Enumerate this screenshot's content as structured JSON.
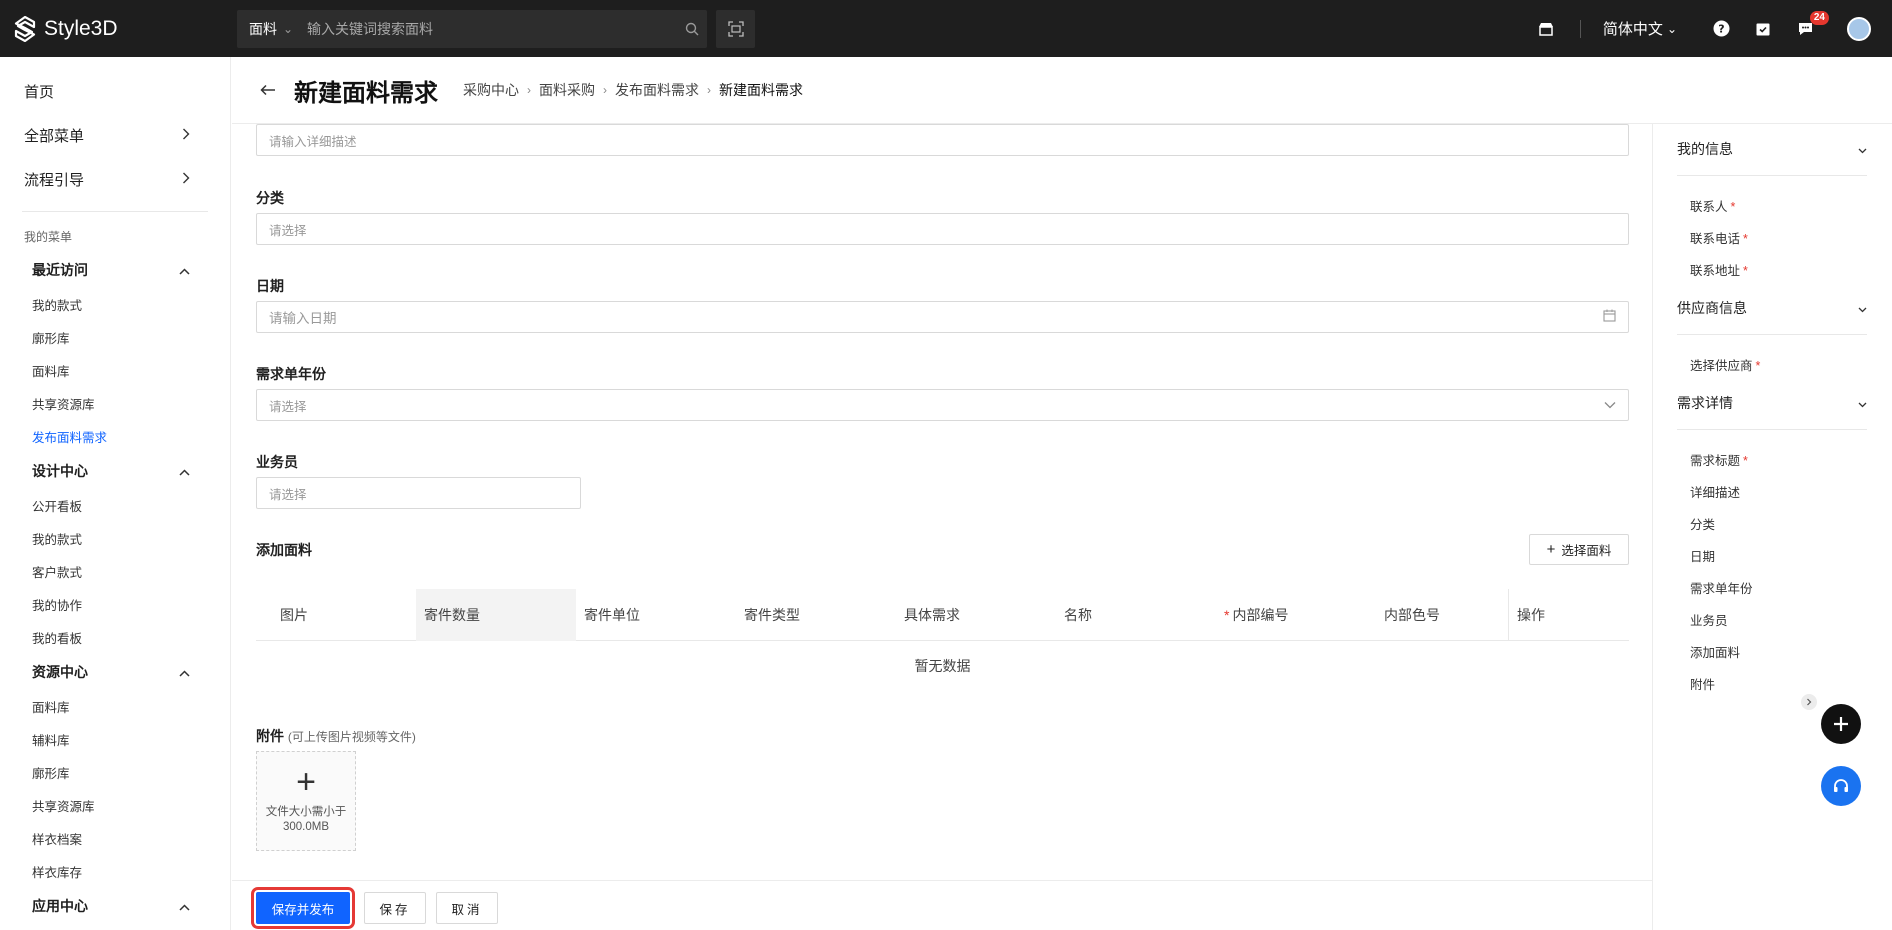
{
  "app": {
    "logo_text": "Style3D"
  },
  "topbar": {
    "search_category": "面料",
    "search_placeholder": "输入关键词搜索面料",
    "language": "简体中文",
    "notification_count": "24"
  },
  "sidebar": {
    "top_items": [
      {
        "label": "首页"
      },
      {
        "label": "全部菜单"
      },
      {
        "label": "流程引导"
      }
    ],
    "my_menu_caption": "我的菜单",
    "groups": [
      {
        "title": "最近访问",
        "items": [
          "我的款式",
          "廓形库",
          "面料库",
          "共享资源库",
          "发布面料需求"
        ]
      },
      {
        "title": "设计中心",
        "items": [
          "公开看板",
          "我的款式",
          "客户款式",
          "我的协作",
          "我的看板"
        ]
      },
      {
        "title": "资源中心",
        "items": [
          "面料库",
          "辅料库",
          "廓形库",
          "共享资源库",
          "样衣档案",
          "样衣库存"
        ]
      },
      {
        "title": "应用中心",
        "items": []
      }
    ]
  },
  "header": {
    "title": "新建面料需求",
    "breadcrumbs": [
      "采购中心",
      "面料采购",
      "发布面料需求",
      "新建面料需求"
    ]
  },
  "form": {
    "detail_placeholder": "请输入详细描述",
    "category_label": "分类",
    "category_placeholder": "请选择",
    "date_label": "日期",
    "date_placeholder": "请输入日期",
    "year_label": "需求单年份",
    "year_placeholder": "请选择",
    "salesman_label": "业务员",
    "salesman_placeholder": "请选择",
    "add_fabric_label": "添加面料",
    "select_fabric_button": "选择面料",
    "table_columns": [
      "图片",
      "寄件数量",
      "寄件单位",
      "寄件类型",
      "具体需求",
      "名称",
      "内部编号",
      "内部色号",
      "操作"
    ],
    "empty_text": "暂无数据",
    "attachment_label": "附件",
    "attachment_hint": "(可上传图片视频等文件)",
    "upload_hint_line1": "文件大小需小于",
    "upload_hint_line2": "300.0MB"
  },
  "footer": {
    "save_publish": "保存并发布",
    "save": "保存",
    "cancel": "取消"
  },
  "right_panel": {
    "sections": [
      {
        "title": "我的信息",
        "items": [
          {
            "label": "联系人",
            "required": true
          },
          {
            "label": "联系电话",
            "required": true
          },
          {
            "label": "联系地址",
            "required": true
          }
        ]
      },
      {
        "title": "供应商信息",
        "items": [
          {
            "label": "选择供应商",
            "required": true
          }
        ]
      },
      {
        "title": "需求详情",
        "items": [
          {
            "label": "需求标题",
            "required": true
          },
          {
            "label": "详细描述",
            "required": false
          },
          {
            "label": "分类",
            "required": false
          },
          {
            "label": "日期",
            "required": false
          },
          {
            "label": "需求单年份",
            "required": false
          },
          {
            "label": "业务员",
            "required": false
          },
          {
            "label": "添加面料",
            "required": false
          },
          {
            "label": "附件",
            "required": false
          }
        ]
      }
    ]
  },
  "colors": {
    "primary": "#1064ff",
    "required": "#e5372e",
    "topbar": "#1e1e1e",
    "highlight_outline": "#e53935"
  }
}
